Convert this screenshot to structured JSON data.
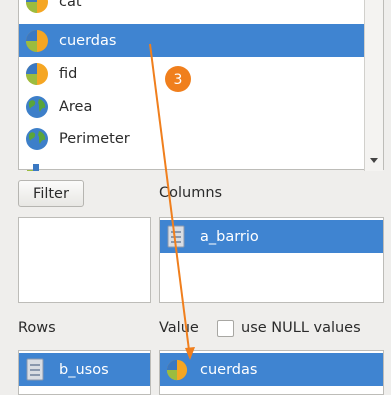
{
  "field_list": {
    "items": [
      {
        "label": "cat",
        "icon": "pie-chart-icon"
      },
      {
        "label": "cuerdas",
        "icon": "pie-chart-icon",
        "selected": true
      },
      {
        "label": "fid",
        "icon": "pie-chart-icon"
      },
      {
        "label": "Area",
        "icon": "globe-icon"
      },
      {
        "label": "Perimeter",
        "icon": "globe-icon"
      }
    ]
  },
  "filter": {
    "button_label": "Filter"
  },
  "columns": {
    "title": "Columns",
    "items": [
      {
        "label": "a_barrio",
        "icon": "text-field-icon"
      }
    ]
  },
  "rows": {
    "title": "Rows",
    "items": [
      {
        "label": "b_usos",
        "icon": "text-field-icon"
      }
    ]
  },
  "value": {
    "title": "Value",
    "use_null_label": "use NULL values",
    "use_null_checked": false,
    "items": [
      {
        "label": "cuerdas",
        "icon": "pie-chart-icon"
      }
    ]
  },
  "annotation": {
    "step_number": "3",
    "badge_color": "#f07f1d",
    "arrow_color": "#f07f1d"
  },
  "colors": {
    "selection": "#3f84d1",
    "background": "#efeeec"
  }
}
